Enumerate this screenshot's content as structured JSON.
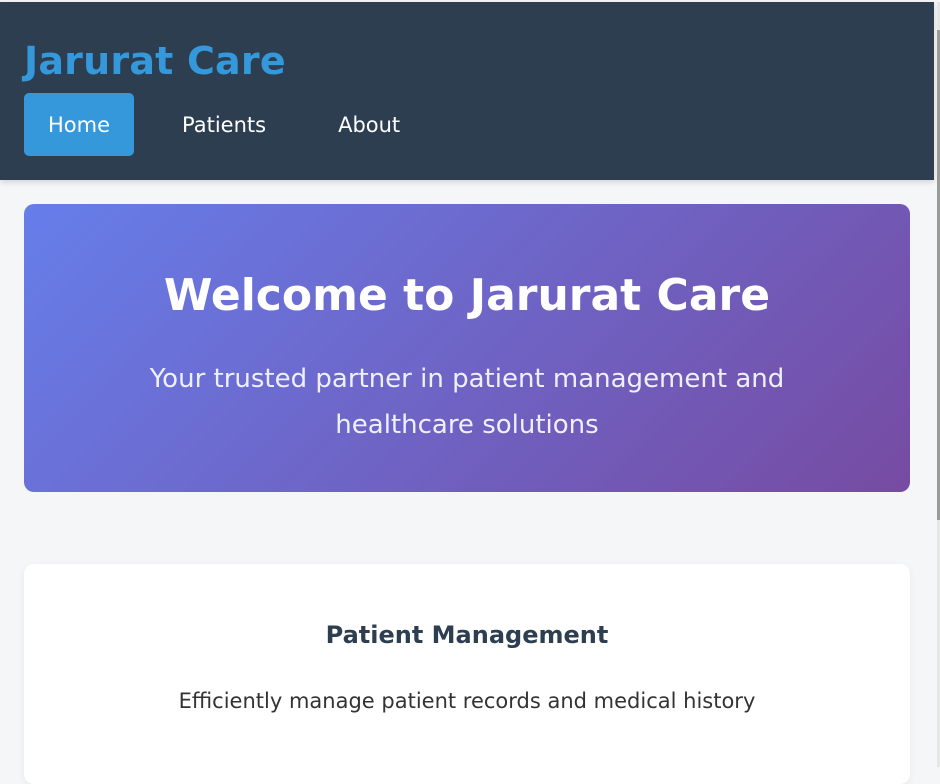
{
  "header": {
    "brand": "Jarurat Care",
    "nav": [
      {
        "label": "Home",
        "active": true
      },
      {
        "label": "Patients",
        "active": false
      },
      {
        "label": "About",
        "active": false
      }
    ]
  },
  "hero": {
    "title": "Welcome to Jarurat Care",
    "subtitle": "Your trusted partner in patient management and healthcare solutions"
  },
  "cards": [
    {
      "title": "Patient Management",
      "text": "Efficiently manage patient records and medical history"
    }
  ],
  "colors": {
    "header_bg": "#2c3e50",
    "accent": "#3498db",
    "hero_gradient_start": "#667eea",
    "hero_gradient_end": "#764ba2",
    "page_bg": "#f5f6f8"
  }
}
